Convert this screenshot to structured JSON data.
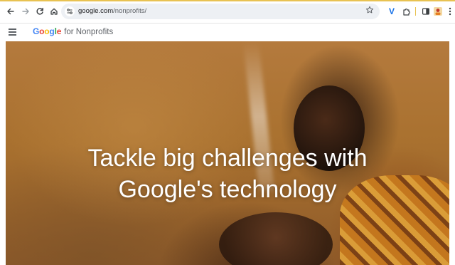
{
  "browser": {
    "url_domain": "google.com",
    "url_path": "/nonprofits/",
    "extension_label": "V",
    "accent_color": "#e8c252"
  },
  "site": {
    "brand_google": "Google",
    "brand_suffix": "for Nonprofits",
    "google_colors": [
      "#4285F4",
      "#EA4335",
      "#FBBC05",
      "#4285F4",
      "#34A853",
      "#EA4335"
    ]
  },
  "hero": {
    "title_line1": "Tackle big challenges with",
    "title_line2": "Google's technology"
  },
  "icons": [
    "back-arrow-icon",
    "forward-arrow-icon",
    "reload-icon",
    "home-icon",
    "site-settings-icon",
    "bookmark-star-icon",
    "extension-v-icon",
    "extensions-puzzle-icon",
    "side-panel-icon",
    "profile-avatar-icon",
    "browser-menu-icon",
    "hamburger-menu-icon"
  ]
}
